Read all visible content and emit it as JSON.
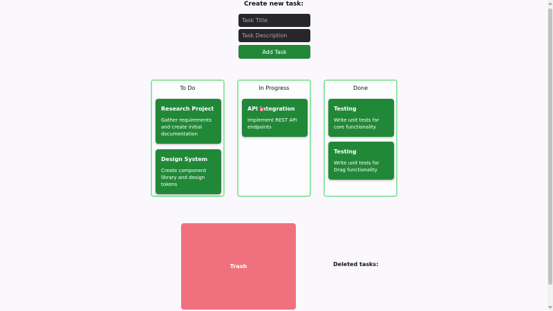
{
  "form": {
    "heading": "Create new task:",
    "title_placeholder": "Task Title",
    "description_placeholder": "Task Description",
    "add_button": "Add Task"
  },
  "columns": [
    {
      "title": "To Do",
      "cards": [
        {
          "title": "Research Project",
          "description": "Gather requirements and create initial documentation"
        },
        {
          "title": "Design System",
          "description": "Create component library and design tokens"
        }
      ]
    },
    {
      "title": "In Progress",
      "cards": [
        {
          "title": "API Integration",
          "description": "Implement REST API endpoints"
        }
      ]
    },
    {
      "title": "Done",
      "cards": [
        {
          "title": "Testing",
          "description": "Write unit tests for core functionality"
        },
        {
          "title": "Testing",
          "description": "Write unit tests for Drag functionality"
        }
      ]
    }
  ],
  "trash": {
    "label": "Trash"
  },
  "deleted": {
    "label": "Deleted tasks:"
  },
  "colors": {
    "accent": "#218838",
    "column_border": "#8fe6a4",
    "trash": "#f0707d",
    "input_bg": "#26262b"
  }
}
